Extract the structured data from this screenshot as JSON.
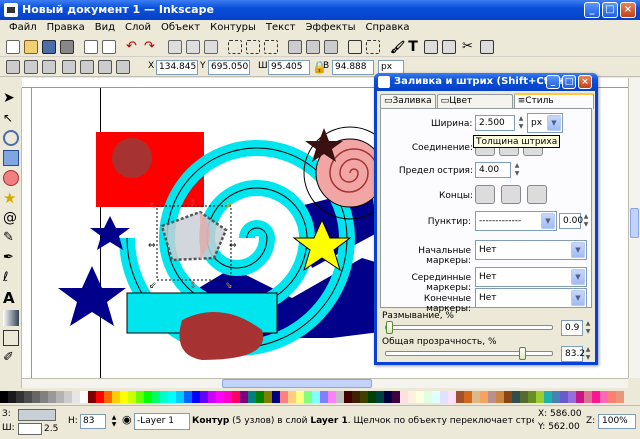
{
  "window": {
    "title": "Новый документ 1 — Inkscape",
    "min": "_",
    "max": "□",
    "close": "×"
  },
  "menu": [
    "Файл",
    "Правка",
    "Вид",
    "Слой",
    "Объект",
    "Контуры",
    "Текст",
    "Эффекты",
    "Справка"
  ],
  "toolbar": {
    "x_label": "X",
    "x_value": "134.845",
    "y_label": "Y",
    "y_value": "695.050",
    "w_label": "Ш",
    "w_value": "95.405",
    "h_label": "В",
    "h_value": "94.888",
    "unit": "px"
  },
  "dialog": {
    "title": "Заливка и штрих (Shift+Ctrl+F)",
    "tabs": [
      "Заливка",
      "Цвет штриха",
      "Стиль штриха"
    ],
    "active_tab": 2,
    "width_label": "Ширина:",
    "width_value": "2.500",
    "width_unit": "px",
    "tooltip": "Толщина штриха",
    "join_label": "Соединение:",
    "miter_label": "Предел острия:",
    "miter_value": "4.00",
    "caps_label": "Концы:",
    "dash_label": "Пунктир:",
    "dash_value": "-------------",
    "dash_offset": "0.00",
    "start_marker_label": "Начальные маркеры:",
    "start_marker_value": "Нет",
    "mid_marker_label": "Серединные маркеры:",
    "mid_marker_value": "Нет",
    "end_marker_label": "Конечные маркеры:",
    "end_marker_value": "Нет",
    "blur_label": "Размывание, %",
    "blur_value": "0.9",
    "blur_fraction": 0.009,
    "opacity_label": "Общая прозрачность, %",
    "opacity_value": "83.2",
    "opacity_fraction": 0.832
  },
  "status": {
    "fill_label": "З:",
    "stroke_label": "Ш:",
    "stroke_width": "2.5",
    "h_label": "Н:",
    "h_value": "83",
    "layer": "-Layer 1",
    "message_bold": "Контур",
    "message_rest": " (5 узлов) в слой ",
    "message_layer": "Layer 1",
    "message_tail": ". Щелчок по объекту переключает стрелки масштабирова",
    "x_coord": "X: 586.00",
    "y_coord": "Y: 562.00",
    "z_label": "Z:",
    "zoom": "100%"
  },
  "colors": {
    "accent": "#0a4fd9",
    "cyan": "#00e5ee",
    "navy": "#00008b",
    "red": "#ff0000",
    "yellow": "#ffff00",
    "pink": "#f2a5a5",
    "brick": "#a63232"
  },
  "palette": [
    "#000000",
    "#1a1a1a",
    "#333333",
    "#4d4d4d",
    "#666666",
    "#808080",
    "#999999",
    "#b3b3b3",
    "#cccccc",
    "#e6e6e6",
    "#ffffff",
    "#800000",
    "#ff0000",
    "#ff6600",
    "#ffcc00",
    "#ffff00",
    "#ccff00",
    "#66ff00",
    "#00ff00",
    "#00ff66",
    "#00ffcc",
    "#00ffff",
    "#00ccff",
    "#0066ff",
    "#0000ff",
    "#6600ff",
    "#cc00ff",
    "#ff00ff",
    "#ff00cc",
    "#ff0066",
    "#800080",
    "#008080",
    "#008000",
    "#808000",
    "#000080",
    "#ff8080",
    "#ffcc80",
    "#ffff80",
    "#80ff80",
    "#80ffff",
    "#8080ff",
    "#ff80ff",
    "#c0c0c0",
    "#400000",
    "#402000",
    "#404000",
    "#004000",
    "#004040",
    "#000040",
    "#400040",
    "#ffe0e0",
    "#fff0e0",
    "#ffffe0",
    "#e0ffe0",
    "#e0ffff",
    "#e0e0ff",
    "#ffe0ff",
    "#a0522d",
    "#d2691e",
    "#deb887",
    "#f4a460",
    "#bc8f8f",
    "#cd853f",
    "#8b4513",
    "#2f4f4f",
    "#556b2f",
    "#6b8e23",
    "#9acd32",
    "#20b2aa",
    "#4682b4",
    "#6a5acd",
    "#9370db",
    "#c71585",
    "#db7093",
    "#ff1493",
    "#ff69b4",
    "#fa8072",
    "#e9967a"
  ]
}
